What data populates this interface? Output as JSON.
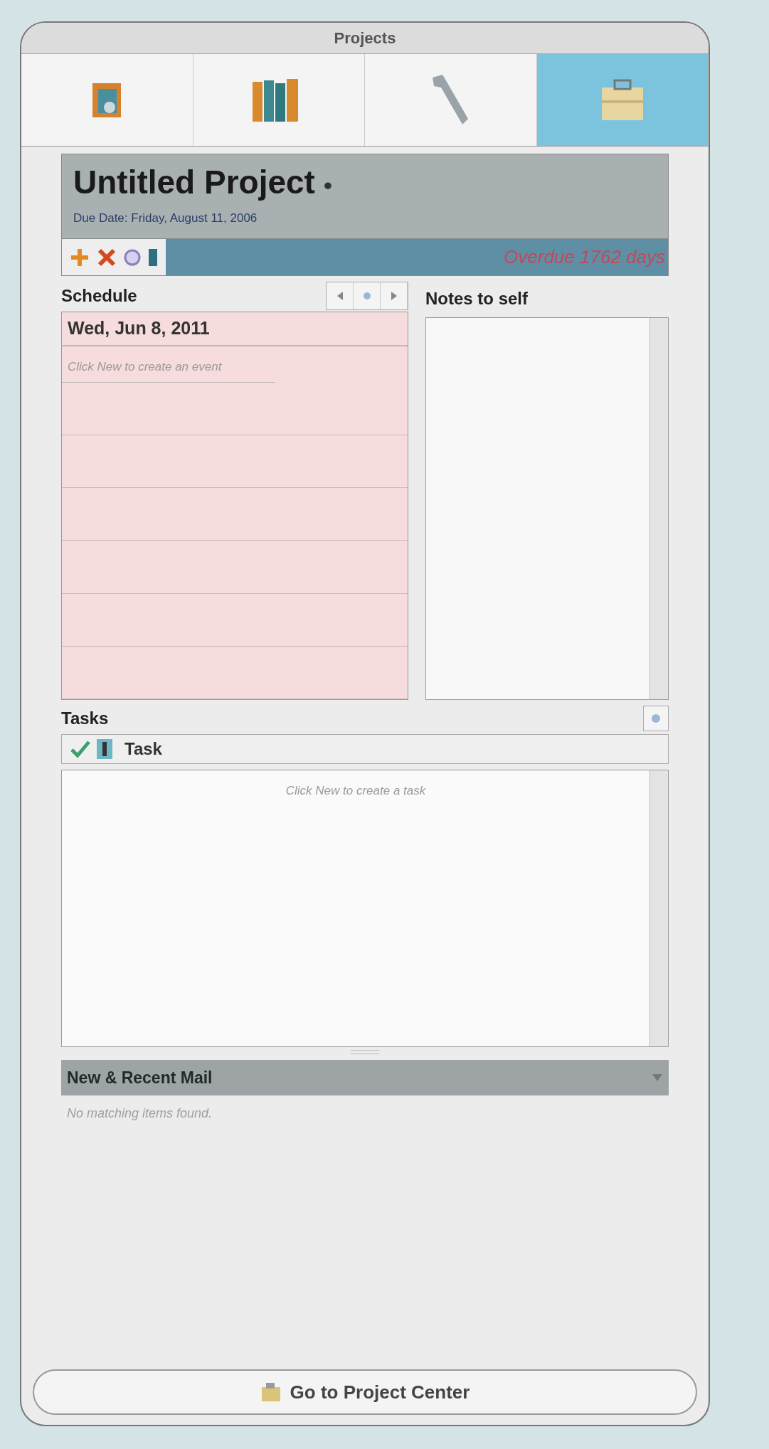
{
  "window": {
    "title": "Projects"
  },
  "toolbar": [
    {
      "kind": "overview",
      "selected": false
    },
    {
      "kind": "books",
      "selected": false
    },
    {
      "kind": "tools",
      "selected": false
    },
    {
      "kind": "box",
      "selected": true
    }
  ],
  "project": {
    "name": "Untitled Project",
    "bullet": "•",
    "due": "Due Date: Friday, August 11, 2006",
    "status": "Overdue 1762 days"
  },
  "schedule": {
    "heading": "Schedule",
    "date": "Wed, Jun 8, 2011",
    "empty_hint": "Click New to create an event"
  },
  "notes": {
    "heading": "Notes to self"
  },
  "tasks": {
    "heading": "Tasks",
    "column": "Task",
    "empty_hint": "Click New to create a task"
  },
  "mail": {
    "heading": "New & Recent Mail",
    "empty_hint": "No matching items found."
  },
  "footer_button": "Go to Project Center"
}
